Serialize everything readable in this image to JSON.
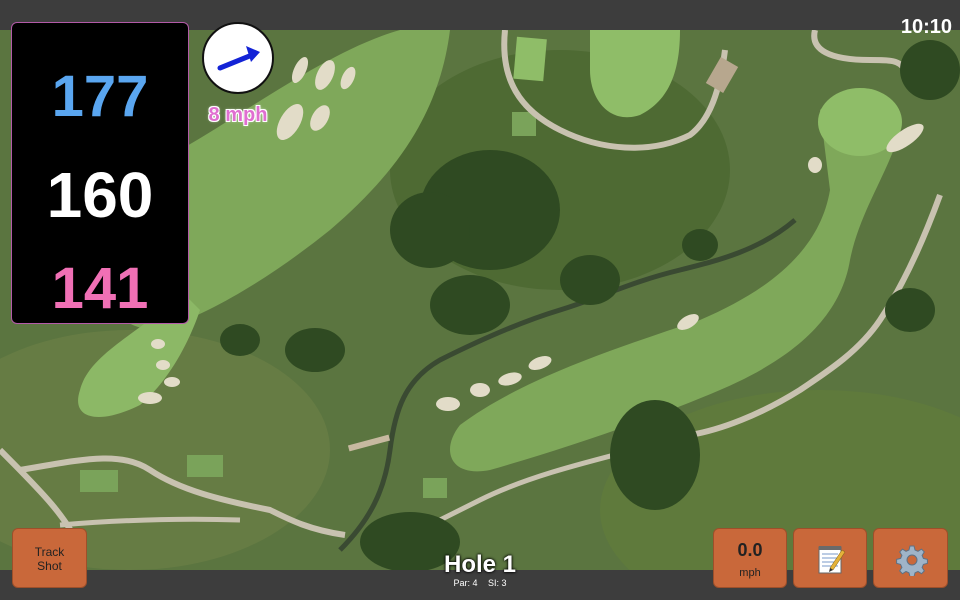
{
  "status": {
    "time": "10:10"
  },
  "distances": {
    "back": "177",
    "center": "160",
    "front": "141"
  },
  "wind": {
    "speed_label": "8 mph",
    "icon": "wind-arrow-icon"
  },
  "buttons": {
    "track_shot": "Track Shot",
    "wind_value": "0.0",
    "wind_unit": "mph",
    "notes_icon": "notepad-icon",
    "settings_icon": "gear-icon"
  },
  "hole": {
    "title": "Hole 1",
    "par": "Par: 4",
    "si": "SI: 3"
  },
  "colors": {
    "back": "#5aa6f0",
    "center": "#ffffff",
    "front": "#f070b5",
    "button": "#c9683a",
    "wind_label": "#e06fd0"
  }
}
